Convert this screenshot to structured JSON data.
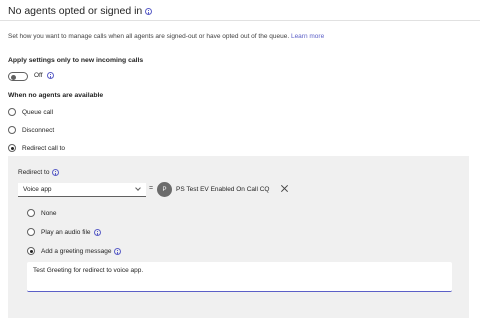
{
  "section": {
    "title": "No agents opted or signed in",
    "description": "Set how you want to manage calls when all agents are signed-out or have opted out of the queue.",
    "learn_more": "Learn more"
  },
  "apply_settings": {
    "label": "Apply settings only to new incoming calls",
    "toggle_state": "Off",
    "toggle_on": false
  },
  "when_no_agents": {
    "label": "When no agents are available",
    "options": [
      {
        "label": "Queue call",
        "selected": false
      },
      {
        "label": "Disconnect",
        "selected": false
      },
      {
        "label": "Redirect call to",
        "selected": true
      }
    ]
  },
  "redirect": {
    "label": "Redirect to",
    "select_value": "Voice app",
    "equals": "=",
    "target": {
      "avatar_initial": "P",
      "name": "PS Test EV Enabled On Call CQ"
    },
    "sub_options": [
      {
        "label": "None",
        "selected": false
      },
      {
        "label": "Play an audio file",
        "selected": false
      },
      {
        "label": "Add a greeting message",
        "selected": true
      }
    ],
    "greeting_text": "Test Greeting for redirect to voice app."
  },
  "colors": {
    "accent": "#5b5fc7",
    "panel": "#f0f0f0"
  }
}
